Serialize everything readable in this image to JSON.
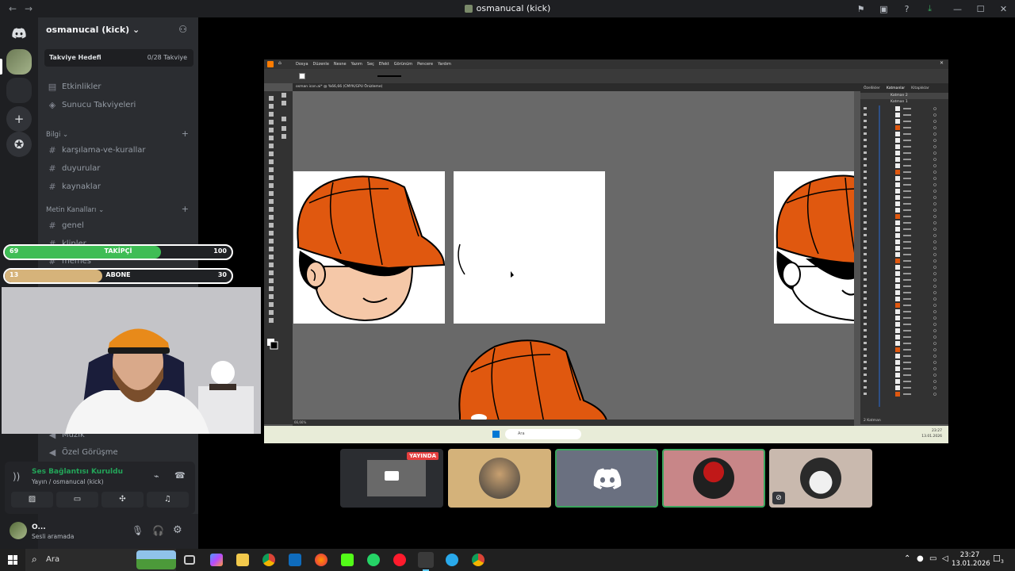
{
  "window": {
    "title": "osmanucal (kick)",
    "back_icon": "arrow-left-icon",
    "forward_icon": "arrow-right-icon"
  },
  "server": {
    "name": "osmanucal (kick)",
    "boost_label": "Takviye Hedefi",
    "boost_count": "0/28 Takviye",
    "events": "Etkinlikler",
    "boosters": "Sunucu Takviyeleri",
    "categories": [
      {
        "name": "Bilgi",
        "channels": [
          "karşılama-ve-kurallar",
          "duyurular",
          "kaynaklar"
        ]
      },
      {
        "name": "Metin Kanalları",
        "channels": [
          "genel",
          "klipler",
          "memes"
        ]
      }
    ],
    "voice_channels": [
      "Müzik",
      "Özel Görüşme"
    ]
  },
  "overlay": {
    "followers": {
      "current": "69",
      "label": "TAKİPÇİ",
      "goal": "100",
      "progress": 0.69,
      "color": "#3fbd55"
    },
    "subscribers": {
      "current": "13",
      "label": "ABONE",
      "goal": "30",
      "progress": 0.43,
      "color": "#d6b37a"
    }
  },
  "voice": {
    "status": "Ses Bağlantısı Kuruldu",
    "detail": "Yayın / osmanucal (kick)"
  },
  "user": {
    "name": "O...",
    "status": "Sesli aramada"
  },
  "illustrator": {
    "menu": [
      "Dosya",
      "Düzenle",
      "Nesne",
      "Yazım",
      "Seç",
      "Efekt",
      "Görünüm",
      "Pencere",
      "Yardım"
    ],
    "doc_tab": "osman icon.ai* @ %66,66 (CMYK/GPU Önizleme)",
    "zoom": "66,66%",
    "panel_tabs": [
      "Özellikler",
      "Katmanlar",
      "Kitaplıklar"
    ],
    "layers": [
      "Katman 2",
      "Katman 1"
    ],
    "layer_count": "2 Katman",
    "taskbar_search": "Ara",
    "inner_time": "23:27",
    "inner_date": "13.01.2026"
  },
  "tiles": {
    "live_badge": "YAYINDA"
  },
  "taskbar": {
    "search_placeholder": "Ara",
    "time": "23:27",
    "date": "13.01.2026",
    "notifications": "3"
  },
  "colors": {
    "cap_orange": "#e0580f",
    "discord_blurple": "#5865f2"
  }
}
